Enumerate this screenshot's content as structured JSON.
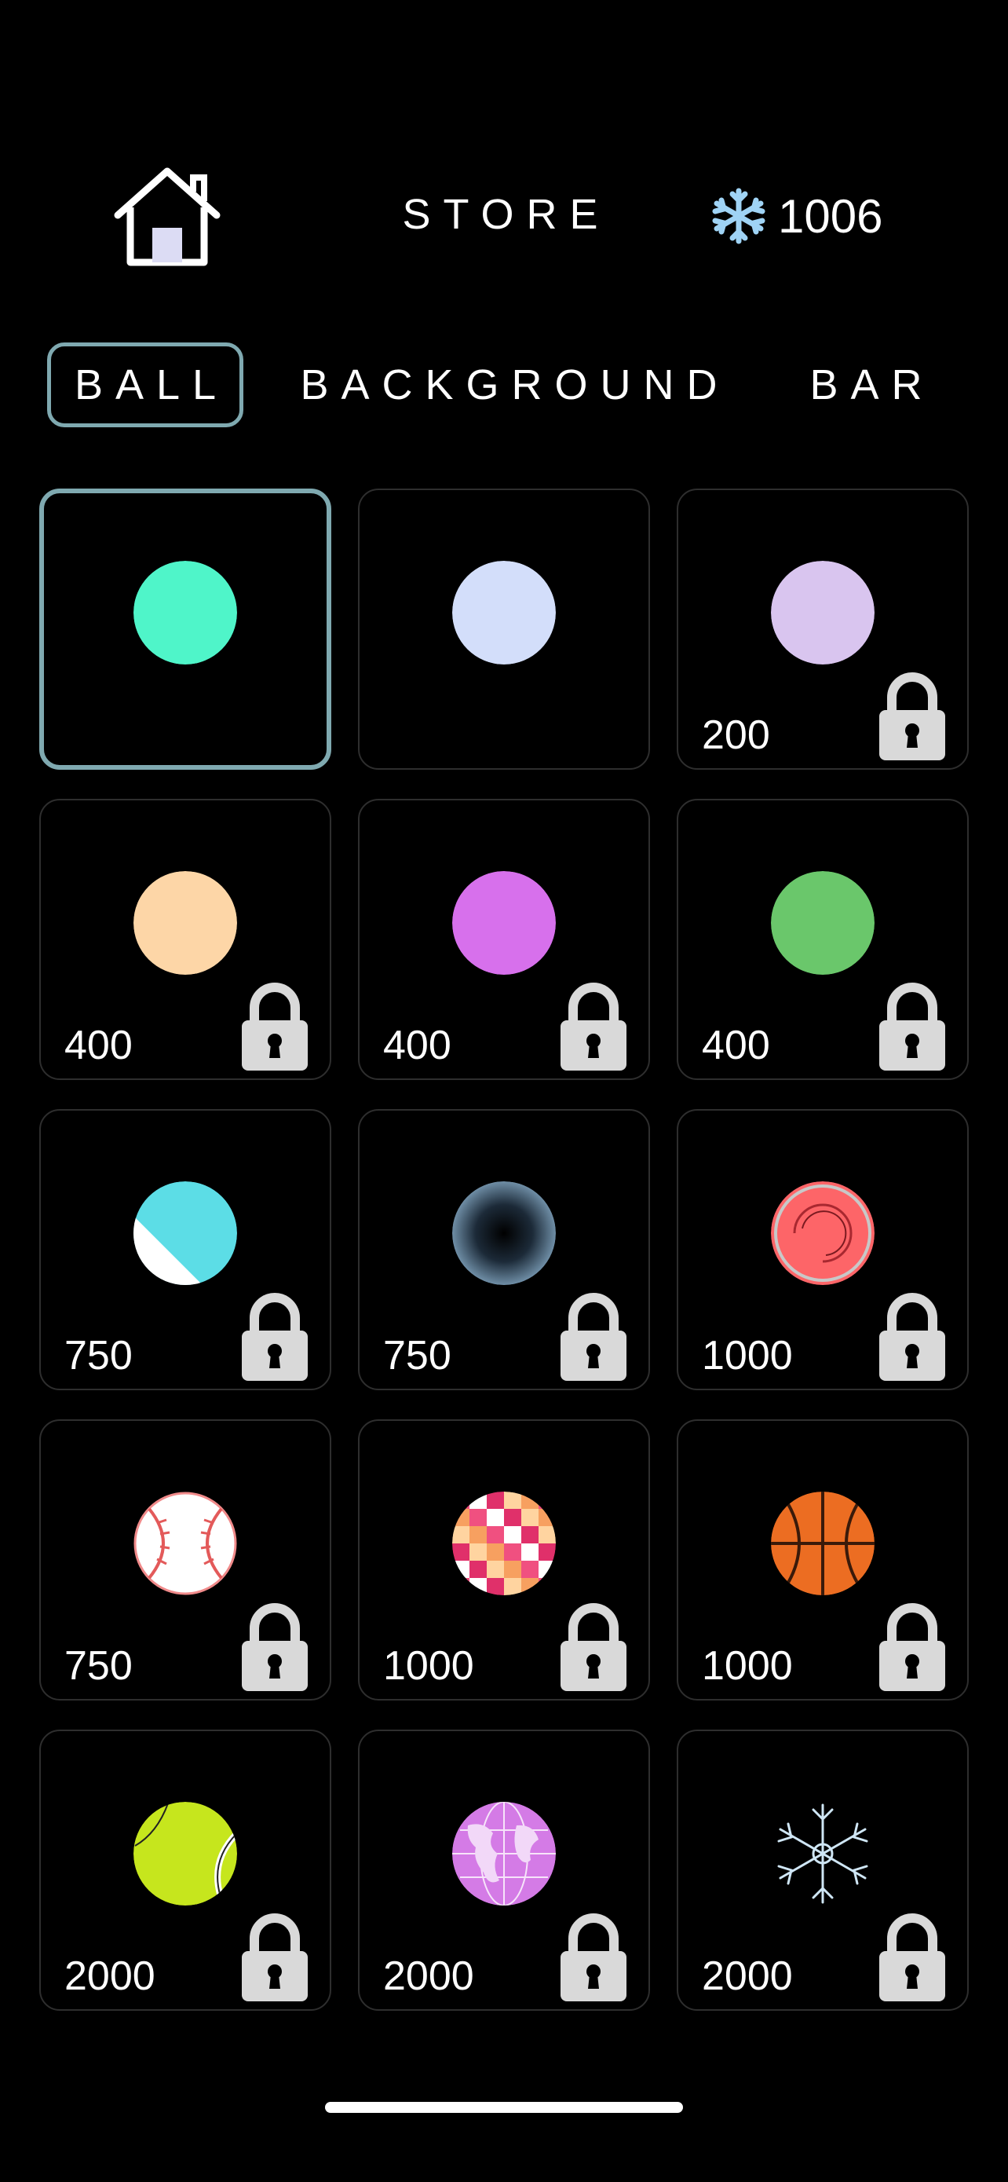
{
  "header": {
    "title": "STORE",
    "currency_value": "1006",
    "currency_icon": "snowflake-icon",
    "home_icon": "home-icon"
  },
  "tabs": [
    {
      "label": "BALL",
      "active": true
    },
    {
      "label": "BACKGROUND",
      "active": false
    },
    {
      "label": "BAR",
      "active": false
    }
  ],
  "items": [
    {
      "name": "mint",
      "price": "",
      "locked": false,
      "selected": true,
      "color": "#4ff5c9"
    },
    {
      "name": "periwinkle",
      "price": "",
      "locked": false,
      "selected": false,
      "color": "#d3defa"
    },
    {
      "name": "lavender",
      "price": "200",
      "locked": true,
      "selected": false,
      "color": "#d9c5ef"
    },
    {
      "name": "peach",
      "price": "400",
      "locked": true,
      "selected": false,
      "color": "#fdd6a7"
    },
    {
      "name": "magenta",
      "price": "400",
      "locked": true,
      "selected": false,
      "color": "#d770ec"
    },
    {
      "name": "green",
      "price": "400",
      "locked": true,
      "selected": false,
      "color": "#6ac76b"
    },
    {
      "name": "split",
      "price": "750",
      "locked": true,
      "selected": false,
      "color": "#5cdde6"
    },
    {
      "name": "dark-gradient",
      "price": "750",
      "locked": true,
      "selected": false,
      "color": "#6f8ea6"
    },
    {
      "name": "red-swirl",
      "price": "1000",
      "locked": true,
      "selected": false,
      "color": "#fd6568"
    },
    {
      "name": "baseball",
      "price": "750",
      "locked": true,
      "selected": false,
      "color": "#ffffff"
    },
    {
      "name": "disco",
      "price": "1000",
      "locked": true,
      "selected": false,
      "color": "#f05080"
    },
    {
      "name": "basketball",
      "price": "1000",
      "locked": true,
      "selected": false,
      "color": "#ec6d22"
    },
    {
      "name": "tennis",
      "price": "2000",
      "locked": true,
      "selected": false,
      "color": "#c6e61d"
    },
    {
      "name": "globe",
      "price": "2000",
      "locked": true,
      "selected": false,
      "color": "#d47be6"
    },
    {
      "name": "snowflake",
      "price": "2000",
      "locked": true,
      "selected": false,
      "color": "#cfe6f5"
    }
  ],
  "colors": {
    "background": "#000000",
    "accent_border": "#7fa9b0",
    "lock": "#d9d9d9",
    "card_border": "#2e2e2e"
  }
}
